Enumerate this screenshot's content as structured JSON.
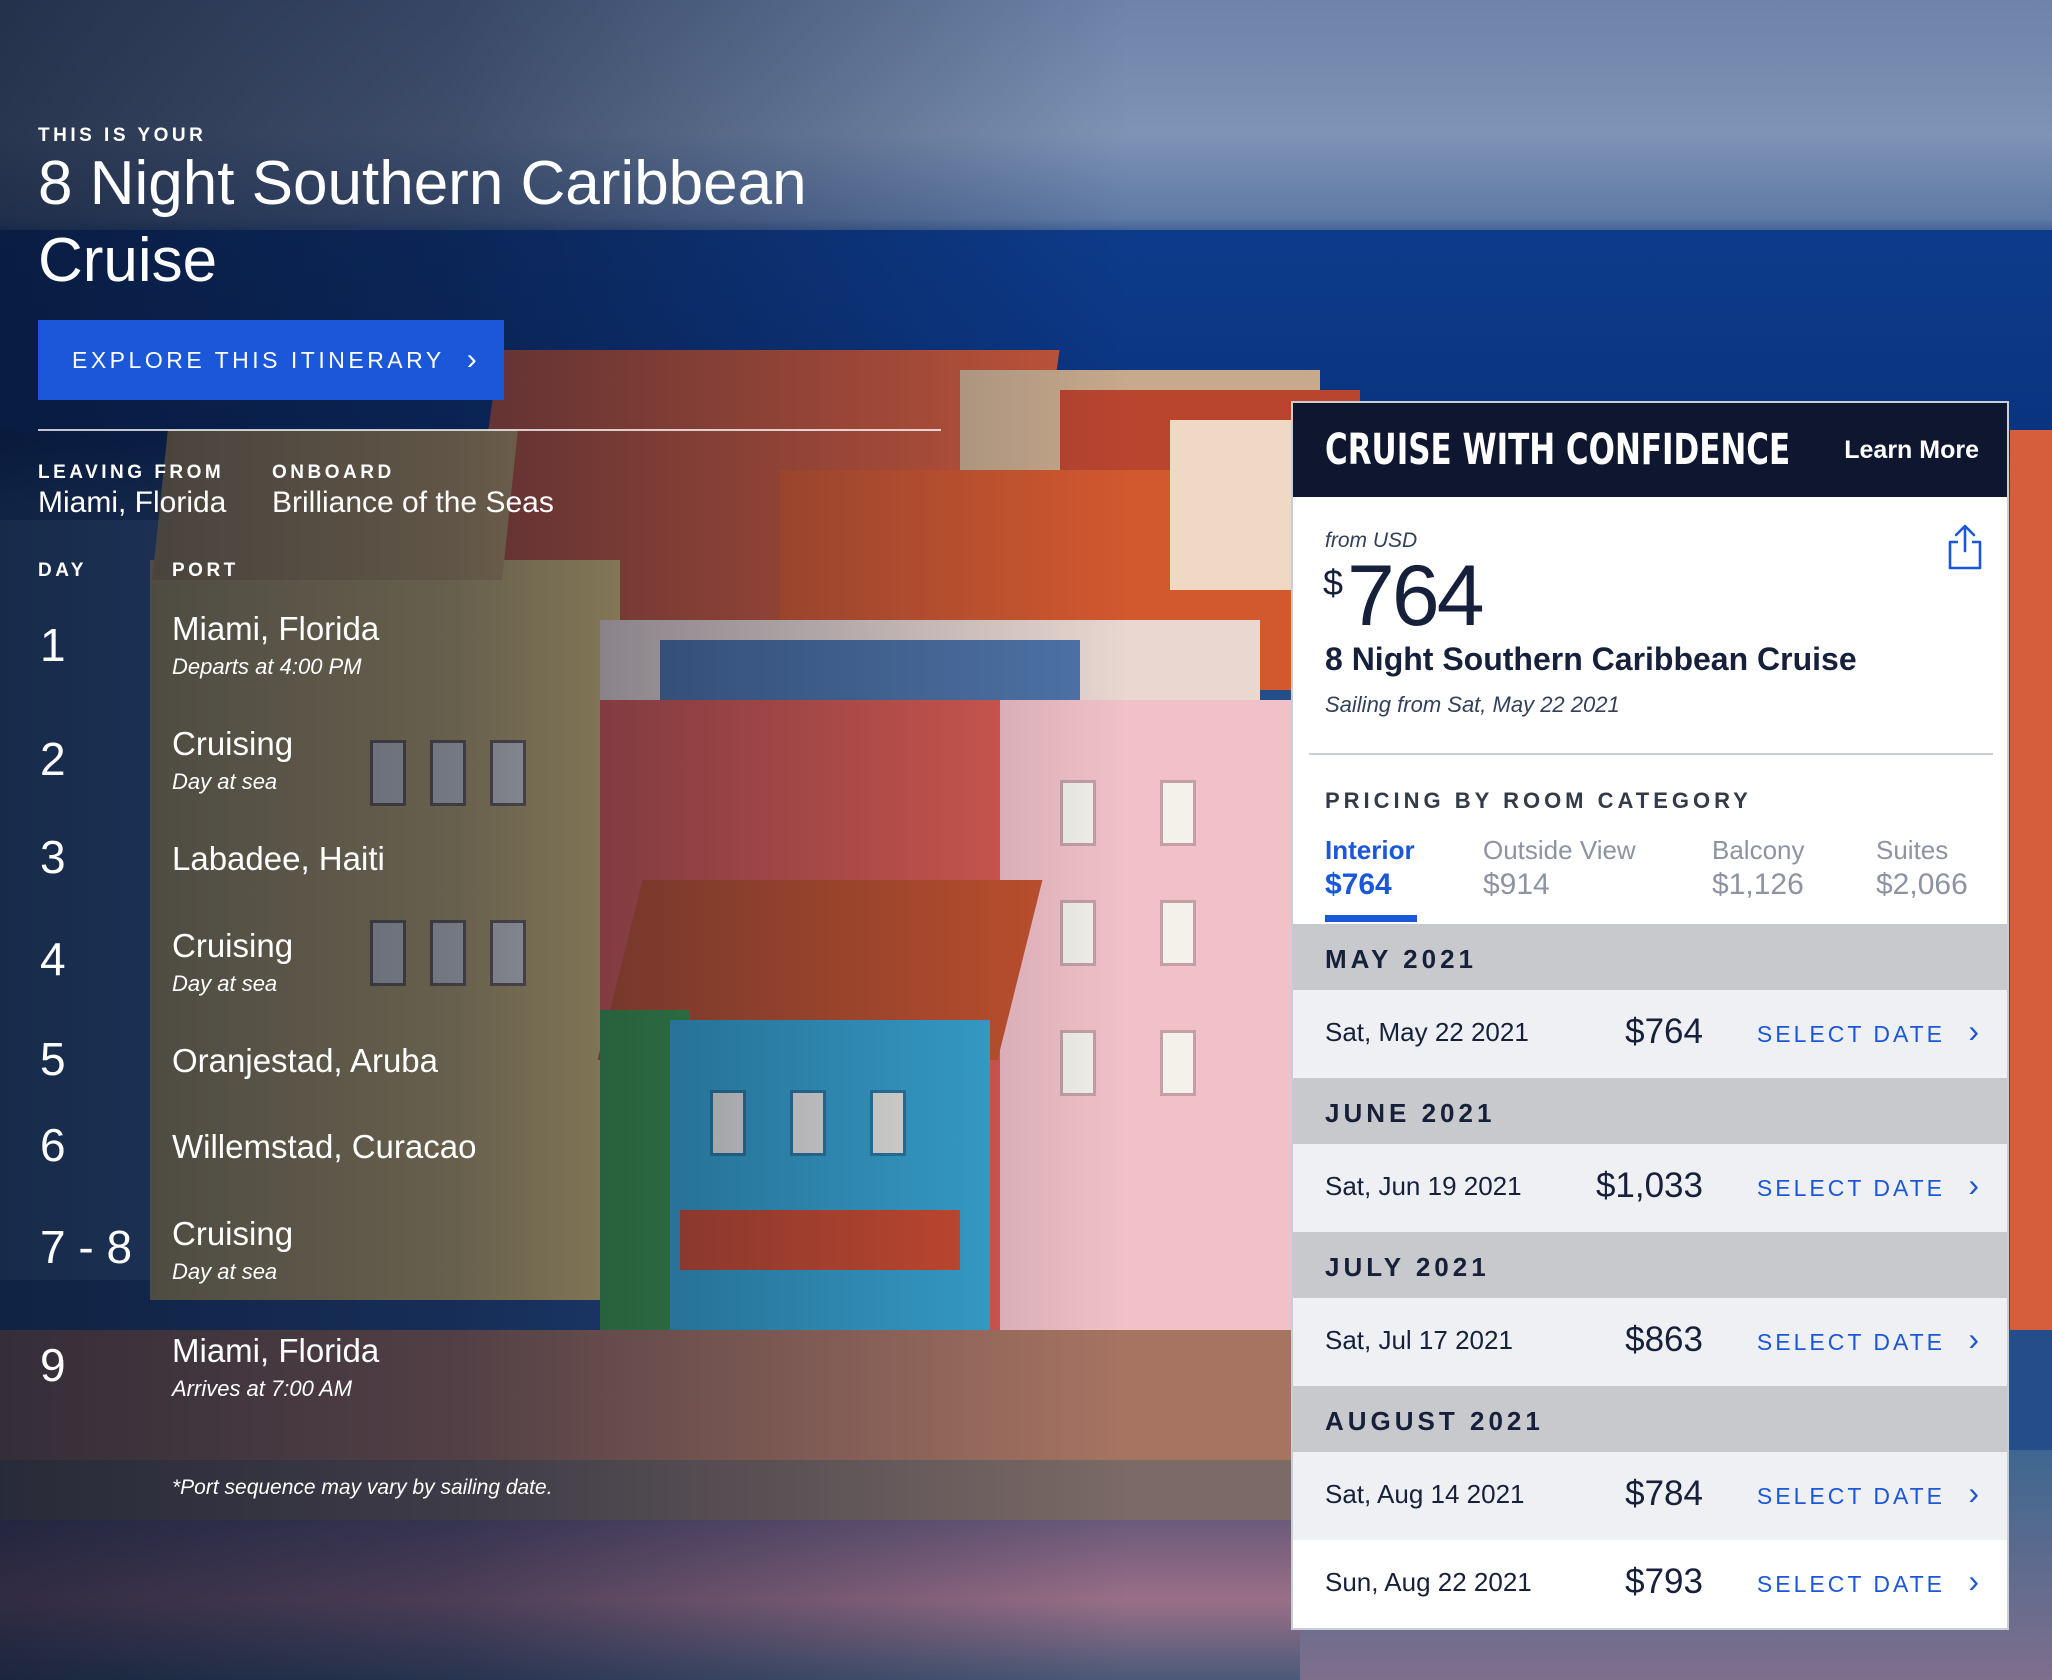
{
  "hero": {
    "kicker": "THIS IS YOUR",
    "title": "8 Night Southern Caribbean Cruise",
    "explore_label": "EXPLORE THIS ITINERARY",
    "leaving_label": "LEAVING FROM",
    "leaving_value": "Miami, Florida",
    "onboard_label": "ONBOARD",
    "onboard_value": "Brilliance of the Seas"
  },
  "itinerary": {
    "day_header": "DAY",
    "port_header": "PORT",
    "stops": [
      {
        "day": "1",
        "port": "Miami, Florida",
        "note": "Departs at 4:00 PM"
      },
      {
        "day": "2",
        "port": "Cruising",
        "note": "Day at sea"
      },
      {
        "day": "3",
        "port": "Labadee, Haiti",
        "note": ""
      },
      {
        "day": "4",
        "port": "Cruising",
        "note": "Day at sea"
      },
      {
        "day": "5",
        "port": "Oranjestad, Aruba",
        "note": ""
      },
      {
        "day": "6",
        "port": "Willemstad, Curacao",
        "note": ""
      },
      {
        "day": "7 - 8",
        "port": "Cruising",
        "note": "Day at sea"
      },
      {
        "day": "9",
        "port": "Miami, Florida",
        "note": "Arrives at 7:00 AM"
      }
    ],
    "footnote": "*Port sequence may vary by sailing date."
  },
  "card": {
    "banner": "CRUISE WITH CONFIDENCE",
    "learn_more": "Learn More",
    "from_label": "from USD",
    "currency": "$",
    "price": "764",
    "cruise_name": "8 Night Southern Caribbean Cruise",
    "sailing": "Sailing from Sat, May 22 2021",
    "pricing_label": "PRICING BY ROOM CATEGORY",
    "tabs": [
      {
        "name": "Interior",
        "price": "$764",
        "active": true
      },
      {
        "name": "Outside View",
        "price": "$914",
        "active": false
      },
      {
        "name": "Balcony",
        "price": "$1,126",
        "active": false
      },
      {
        "name": "Suites",
        "price": "$2,066",
        "active": false
      }
    ],
    "select_label": "SELECT DATE",
    "months": [
      {
        "name": "MAY 2021",
        "dates": [
          {
            "date": "Sat, May 22 2021",
            "price": "$764"
          }
        ]
      },
      {
        "name": "JUNE 2021",
        "dates": [
          {
            "date": "Sat, Jun 19 2021",
            "price": "$1,033"
          }
        ]
      },
      {
        "name": "JULY 2021",
        "dates": [
          {
            "date": "Sat, Jul 17 2021",
            "price": "$863"
          }
        ]
      },
      {
        "name": "AUGUST 2021",
        "dates": [
          {
            "date": "Sat, Aug 14 2021",
            "price": "$784"
          },
          {
            "date": "Sun, Aug 22 2021",
            "price": "$793"
          }
        ]
      }
    ]
  },
  "colors": {
    "accent": "#1b57d9",
    "card_header": "#0f1730",
    "month_band": "#c8c9cc"
  },
  "icons": {
    "explore_chevron": "chevron-right-icon",
    "share": "share-icon",
    "select_chevron": "chevron-right-icon"
  }
}
